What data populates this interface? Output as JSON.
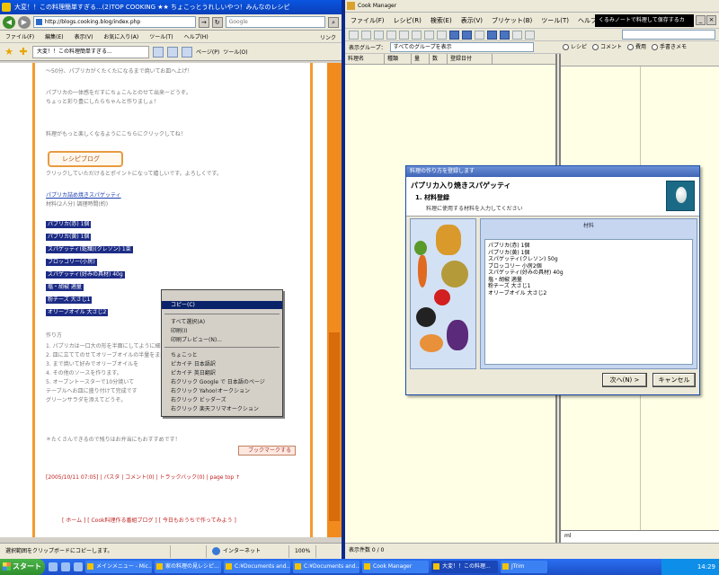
{
  "browser": {
    "title": "大変！！この料理簡単すぎる...(2)TOP COOKING ★★ ちょこっとうれしいやつ！みんなのレシピ",
    "address": "http://blogs.cooking.blog/index.php",
    "search_placeholder": "Google",
    "go_label": "→",
    "menu": [
      "ファイル(F)",
      "編集(E)",
      "表示(V)",
      "お気に入り(A)",
      "ツール(T)",
      "ヘルプ(H)"
    ],
    "menu_right": "リンク",
    "tab_label": "大変！！この料理簡単すぎる...",
    "tool_labels": [
      "ページ(P)",
      "ツール(O)"
    ],
    "content": {
      "intro_lines": [
        "〜50分、パプリカがくたくたになるまで焼いてお皿へ上げ！",
        "",
        "パプリカの一体感をだすにちょこんとのせて出来ーどうぞ。",
        "ちょっと彩り豊にしたらちゃんと作りましょ！",
        "",
        "料理がもっと楽しくなるようにこちらにクリックしてね！"
      ],
      "recipe_logo": "レシピブログ",
      "link_note": "クリックしていただけるとポイントになって嬉しいです。よろしくです。",
      "recipe_title": "パプリカ詰め焼きスパゲッティ",
      "servings": "材料(2人分)  調理時間(約)",
      "ingredients_highlight": [
        "パプリカ(赤) 1個",
        "パプリカ(黄) 1個",
        "スパゲッティ(乾麺)(クレソン) 1束",
        "ブロッコリー(小房)",
        "スパゲッティ(好みの具材) 40g",
        "塩・胡椒 適量",
        "粉チーズ 大さじ1",
        "オリーブオイル 大さじ2"
      ],
      "method_title": "作り方",
      "method_lines": [
        "1. パプリカは一口大の形を半面にしてように細く切ってのせます",
        "2. 皿に立ててのせてオリーブオイルの半量をまわしかけて",
        "3. まで焼いて好みでオリーブオイルを",
        "4. その他のソースを作ります。",
        "5. オーブントースターで10分焼いて",
        "テーブルへお皿に盛り付けて完成です",
        "グリーンサラダを添えてどうぞ。"
      ],
      "closing_line": "＊たくさんできるので残りはお弁当にもおすすめです！",
      "bookmark_label": "ブックマークする",
      "footer_links": "[2005/10/11 07:05] | パスタ | コメント(0) | トラックバック(0) | page top ↑",
      "footer_red": "[ ホーム ] [ Cook料理作る番組ブログ ] [ 今日もおうちで作ってみよう ]"
    },
    "context_menu": {
      "items": [
        {
          "label": "コピー(C)",
          "state": "selected"
        },
        {
          "label": "",
          "state": "sep"
        },
        {
          "label": "すべて選択(A)",
          "state": "normal"
        },
        {
          "label": "印刷(I)",
          "state": "normal"
        },
        {
          "label": "印刷プレビュー(N)...",
          "state": "normal"
        },
        {
          "label": "",
          "state": "sep"
        },
        {
          "label": "ちょこっと",
          "state": "normal"
        },
        {
          "label": "ピカイチ 日本語訳",
          "state": "normal"
        },
        {
          "label": "ピカイチ 英日翻訳",
          "state": "normal"
        },
        {
          "label": "右クリック Google で 日本語のページ",
          "state": "normal"
        },
        {
          "label": "右クリック Yahoo!オークション",
          "state": "normal"
        },
        {
          "label": "右クリック ビッダーズ",
          "state": "normal"
        },
        {
          "label": "右クリック 楽天フリマオークション",
          "state": "normal"
        }
      ]
    },
    "status": {
      "left": "選択範囲をクリップボードにコピーします。",
      "zone": "インターネット",
      "zoom": "100%"
    }
  },
  "cook": {
    "title": "Cook Manager",
    "menu": [
      "ファイル(F)",
      "レシピ(R)",
      "検索(E)",
      "表示(V)",
      "ブリケット(B)",
      "ツール(T)",
      "ヘルプ(H)"
    ],
    "message": "くるみノートで料理して保存するカ",
    "window_buttons": [
      "_",
      "□",
      "×"
    ],
    "group_label": "表示グループ：",
    "group_value": "すべてのグループを表示",
    "columns": [
      "料理名",
      "種類",
      "量",
      "数",
      "登録日付"
    ],
    "right_tabs": [
      "レシピ",
      "コメント",
      "費用",
      "手書きメモ"
    ],
    "bottom_value": "ml",
    "status": "表示件数  0 / 0"
  },
  "dialog": {
    "title": "料理の作り方を登録します",
    "recipe_name": "パプリカ入り焼きスパゲッティ",
    "step_title": "1. 材料登録",
    "step_desc": "料理に使用する材料を入力してください",
    "ingredients_label": "材料",
    "ingredients": [
      "パプリカ(赤) 1個",
      "パプリカ(黄) 1個",
      "スパゲッティ(クレソン) 50g",
      "ブロッコリー 小房2個",
      "スパゲッティ(好みの具材) 40g",
      "塩・胡椒 適量",
      "粉チーズ 大さじ1",
      "オリーブオイル 大さじ2"
    ],
    "next_button": "次へ(N) >",
    "cancel_button": "キャンセル"
  },
  "taskbar": {
    "start": "スタート",
    "tasks": [
      "メインメニュー - Mic...",
      "家の料理の見レシピ...",
      "C:¥Documents and...",
      "C:¥Documents and...",
      "Cook Manager",
      "大変！！この料理...",
      "JTrim"
    ],
    "active_index": 5,
    "clock": "14:29"
  },
  "colors": {
    "accent_orange": "#f39a2e",
    "highlight_navy": "#1c2c86",
    "xp_blue": "#2a6ff0",
    "cook_pane": "#ffffe6"
  }
}
